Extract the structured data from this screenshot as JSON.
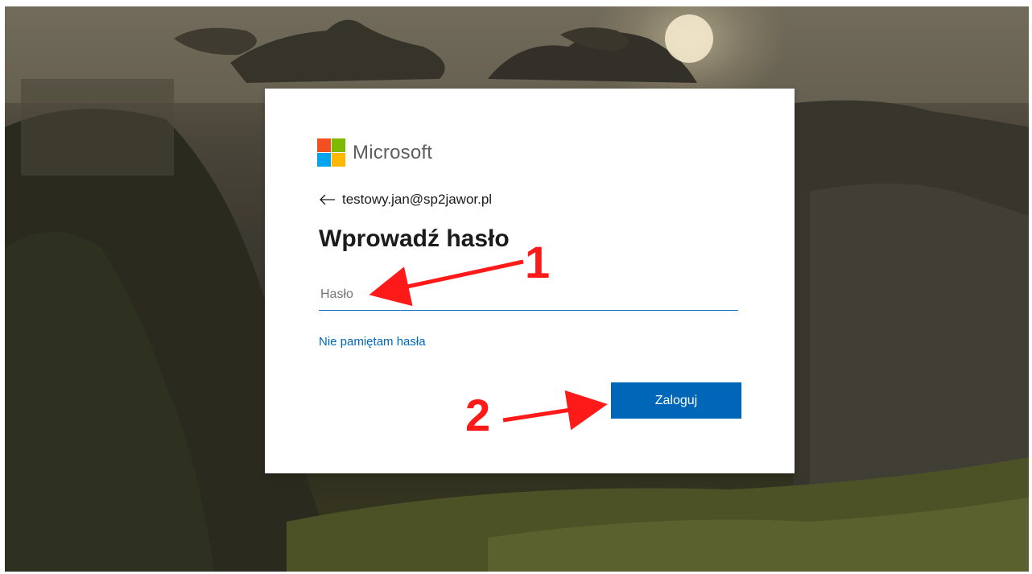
{
  "brand": {
    "name": "Microsoft",
    "logo_colors": [
      "#f25022",
      "#7fba00",
      "#00a4ef",
      "#ffb900"
    ]
  },
  "account": {
    "email": "testowy.jan@sp2jawor.pl",
    "back_icon": "arrow-left-icon"
  },
  "form": {
    "title": "Wprowadź hasło",
    "password_placeholder": "Hasło",
    "password_value": "",
    "forgot_label": "Nie pamiętam hasła",
    "submit_label": "Zaloguj"
  },
  "annotations": {
    "step1": "1",
    "step2": "2",
    "color": "#ff1a1a"
  },
  "colors": {
    "accent": "#0067b8",
    "input_underline": "#1a6fc1"
  }
}
